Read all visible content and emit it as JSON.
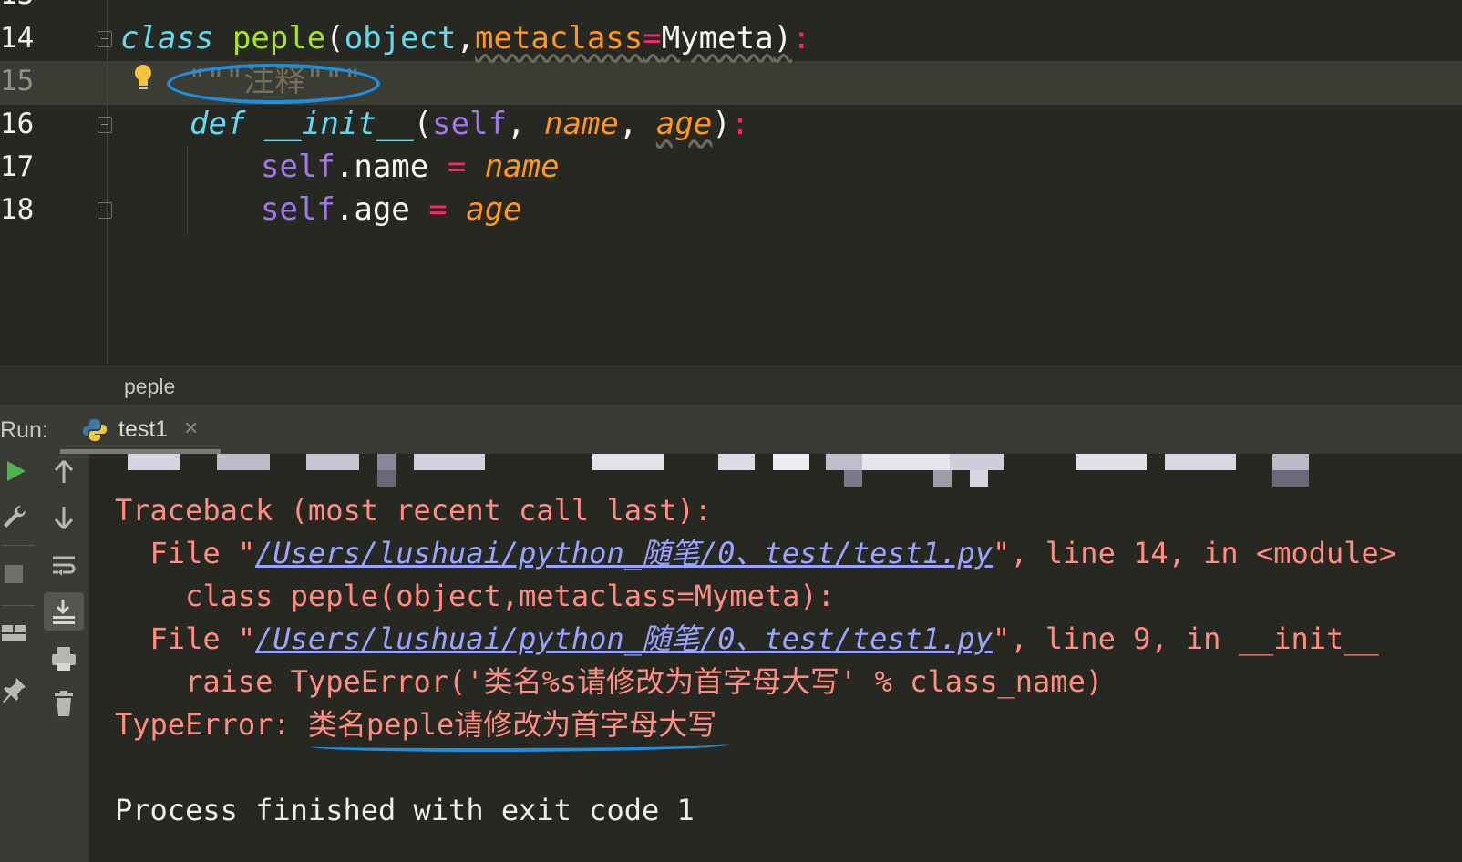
{
  "editor": {
    "lines": [
      {
        "num": "14",
        "k_class": "class",
        "name": "peple",
        "b_object": "object",
        "comma": ",",
        "kwarg": "metaclass",
        "eq": "=",
        "meta": "Mymeta",
        "close": ")",
        "colon": ":",
        "open": "("
      },
      {
        "num": "15",
        "doc": "\"\"\"注释\"\"\""
      },
      {
        "num": "16",
        "k_def": "def",
        "fname": "__init__",
        "open": "(",
        "self": "self",
        "sep1": ", ",
        "p1": "name",
        "sep2": ", ",
        "p2": "age",
        "close": ")",
        "colon": ":"
      },
      {
        "num": "17",
        "self": "self",
        "attr": ".name ",
        "eq": "=",
        "val": "name"
      },
      {
        "num": "18",
        "self": "self",
        "attr": ".age ",
        "eq": "=",
        "val": "age"
      }
    ],
    "colors": {
      "keyword": "#66d9ef",
      "class_name": "#a6e22e",
      "operator": "#f92672",
      "param": "#fd971f",
      "current_line": "#3b3c34"
    }
  },
  "breadcrumb": {
    "text": "peple"
  },
  "run": {
    "label": "Run:",
    "tab": {
      "label": "test1",
      "icon": "python-icon",
      "close": "×"
    }
  },
  "toolbar": {
    "left": [
      "rerun-icon",
      "wrench-icon",
      "stop-icon",
      "layout-icon",
      "pin-icon"
    ],
    "right": [
      "up-arrow-icon",
      "down-arrow-icon",
      "soft-wrap-icon",
      "scroll-to-end-icon",
      "print-icon",
      "trash-icon"
    ]
  },
  "console": {
    "traceback": "Traceback (most recent call last):",
    "file1_pre": "  File \"",
    "file1_path": "/Users/lushuai/python_随笔/0、test/test1.py",
    "file1_post": "\", line 14, in <module>",
    "code1": "    class peple(object,metaclass=Mymeta):",
    "file2_pre": "  File \"",
    "file2_path": "/Users/lushuai/python_随笔/0、test/test1.py",
    "file2_post": "\", line 9, in __init__",
    "code2": "    raise TypeError('类名%s请修改为首字母大写' % class_name)",
    "error_prefix": "TypeError: ",
    "error_msg": "类名peple请修改为首字母大写",
    "exit": "Process finished with exit code 1",
    "colors": {
      "error": "#ff8c82",
      "link": "#9aa3ff",
      "plain": "#f0f0ea"
    }
  }
}
